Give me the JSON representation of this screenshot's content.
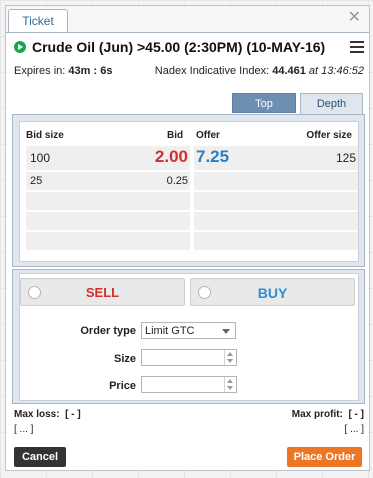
{
  "window": {
    "tab_label": "Ticket",
    "close_glyph": "✕"
  },
  "market": {
    "name": "Crude Oil (Jun) >45.00 (2:30PM) (10-MAY-16)",
    "status_icon": "play-icon",
    "status_color": "#16a84a"
  },
  "info": {
    "expires_label": "Expires in:",
    "expires_value": "43m : 6s",
    "index_label": "Nadex Indicative Index:",
    "index_value": "44.461",
    "index_at": "at",
    "index_time": "13:46:52"
  },
  "tabs": {
    "top_label": "Top",
    "depth_label": "Depth"
  },
  "depth": {
    "headers": {
      "bid_size": "Bid size",
      "bid": "Bid",
      "offer": "Offer",
      "offer_size": "Offer size"
    },
    "rows": [
      {
        "bid_size": "100",
        "bid": "2.00",
        "offer": "7.25",
        "offer_size": "125"
      },
      {
        "bid_size": "25",
        "bid": "0.25",
        "offer": "",
        "offer_size": ""
      }
    ],
    "empty_rows": 3,
    "colors": {
      "bid": "#d03030",
      "offer": "#2c7fc0"
    }
  },
  "order": {
    "sell_label": "SELL",
    "buy_label": "BUY",
    "order_type_label": "Order type",
    "order_type_value": "Limit GTC",
    "size_label": "Size",
    "size_value": "",
    "price_label": "Price",
    "price_value": ""
  },
  "summary": {
    "max_loss_label": "Max loss:",
    "max_loss_value": "[ - ]",
    "max_loss_detail": "[ ... ]",
    "max_profit_label": "Max profit:",
    "max_profit_value": "[ - ]",
    "max_profit_detail": "[ ... ]"
  },
  "actions": {
    "cancel_label": "Cancel",
    "place_label": "Place Order"
  }
}
